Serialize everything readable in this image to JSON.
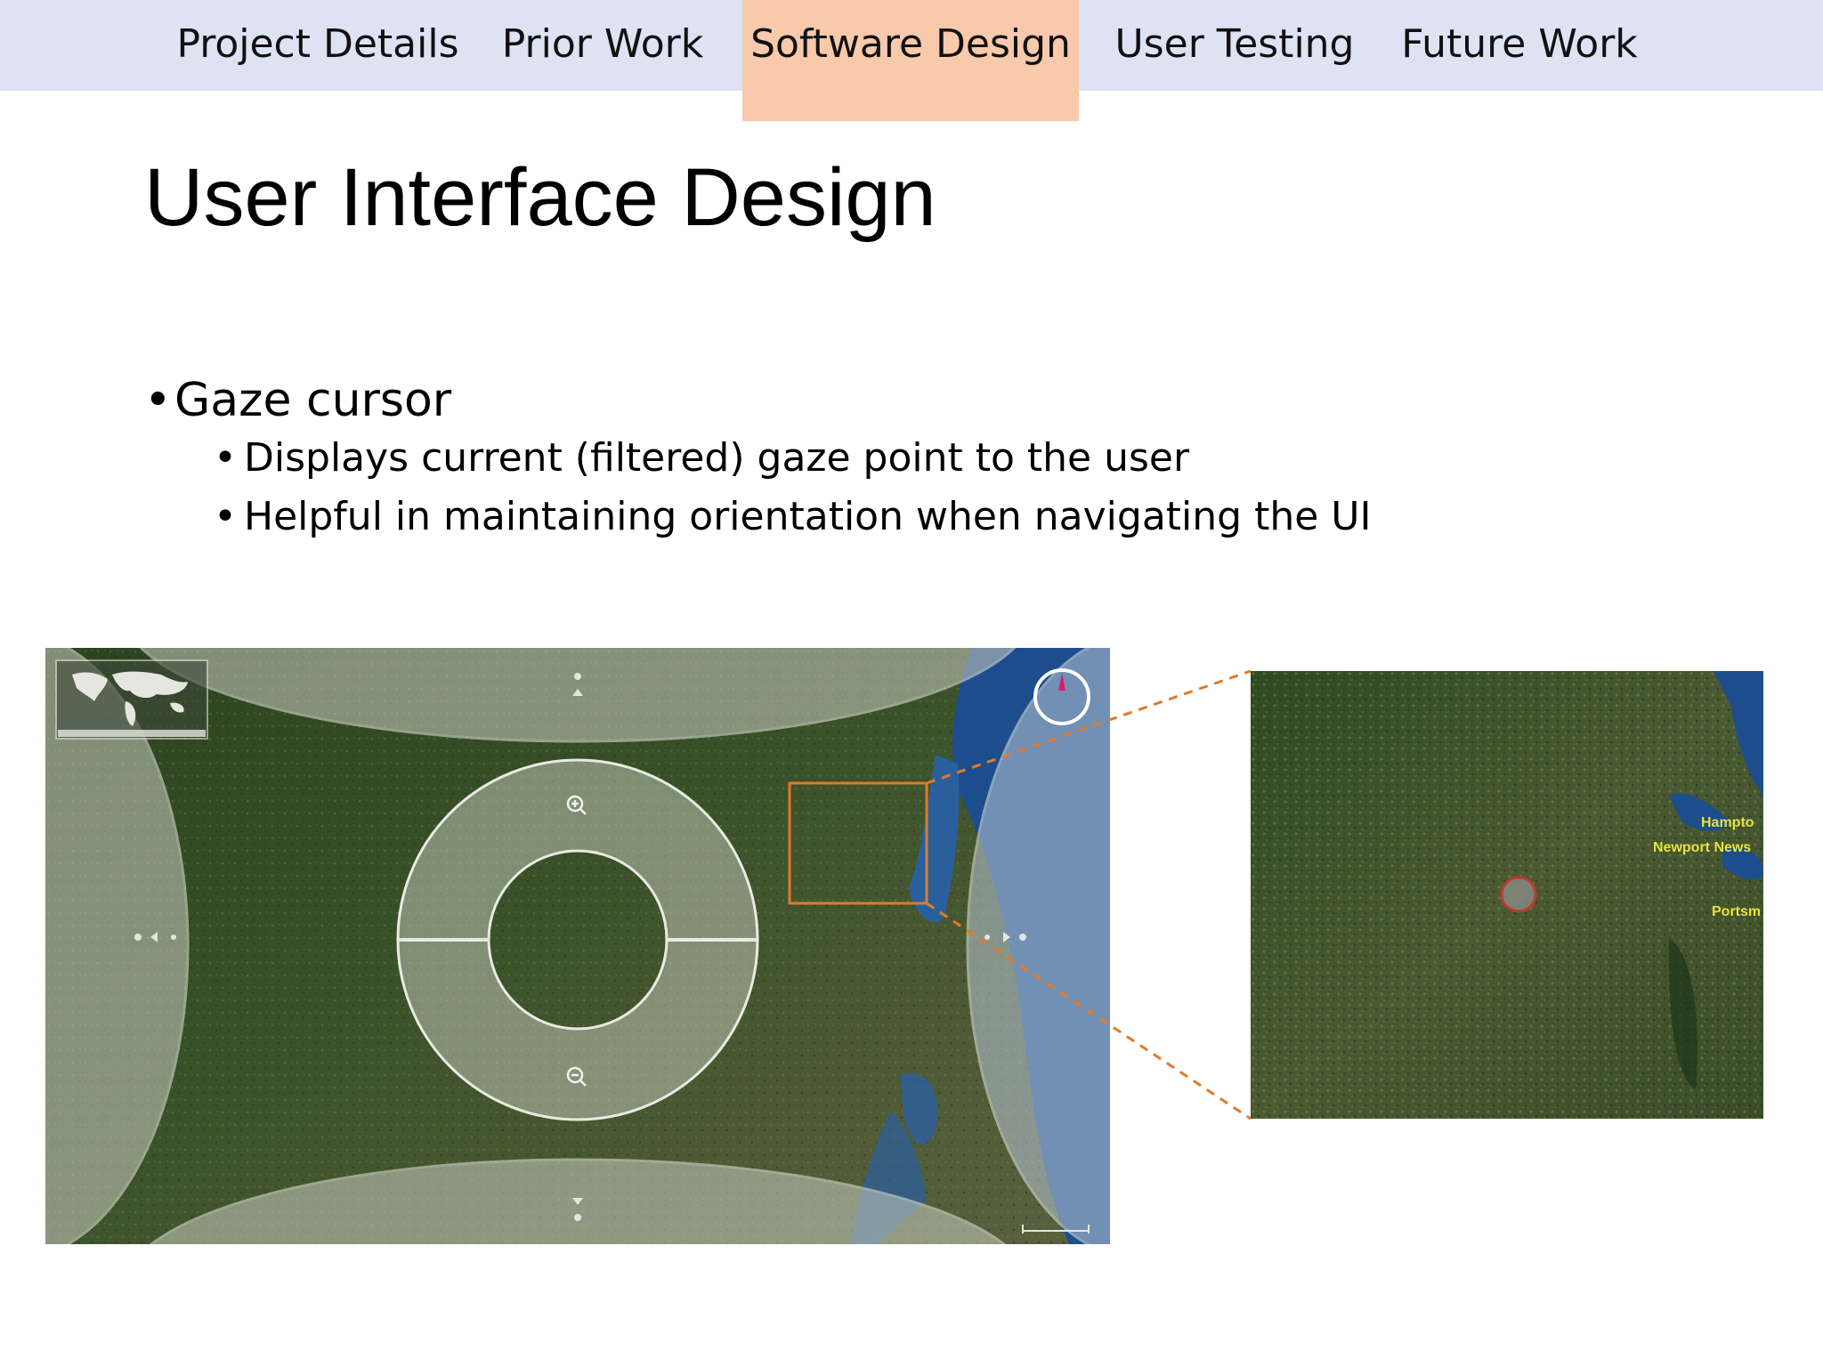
{
  "nav": {
    "tabs": [
      {
        "label": "Project Details",
        "active": false
      },
      {
        "label": "Prior Work",
        "active": false
      },
      {
        "label": "Software Design",
        "active": true
      },
      {
        "label": "User Testing",
        "active": false
      },
      {
        "label": "Future Work",
        "active": false
      }
    ]
  },
  "slide": {
    "title": "User Interface Design",
    "bullets": [
      {
        "text": "Gaze cursor",
        "sub": [
          "Displays current (filtered) gaze point to the user",
          "Helpful in maintaining orientation when navigating the UI"
        ]
      }
    ]
  },
  "map": {
    "zoom_in_icon": "zoom-in-icon",
    "zoom_out_icon": "zoom-out-icon",
    "compass_icon": "compass-icon",
    "minimap_icon": "world-map-icon"
  },
  "zoom_view": {
    "labels": [
      "Hampto",
      "Newport News",
      "Portsm"
    ]
  },
  "colors": {
    "nav_bg": "#dde3f2",
    "active_tab": "#f8c9ab",
    "highlight_box": "#e07a2a",
    "gaze_cursor": "#c0392b"
  }
}
